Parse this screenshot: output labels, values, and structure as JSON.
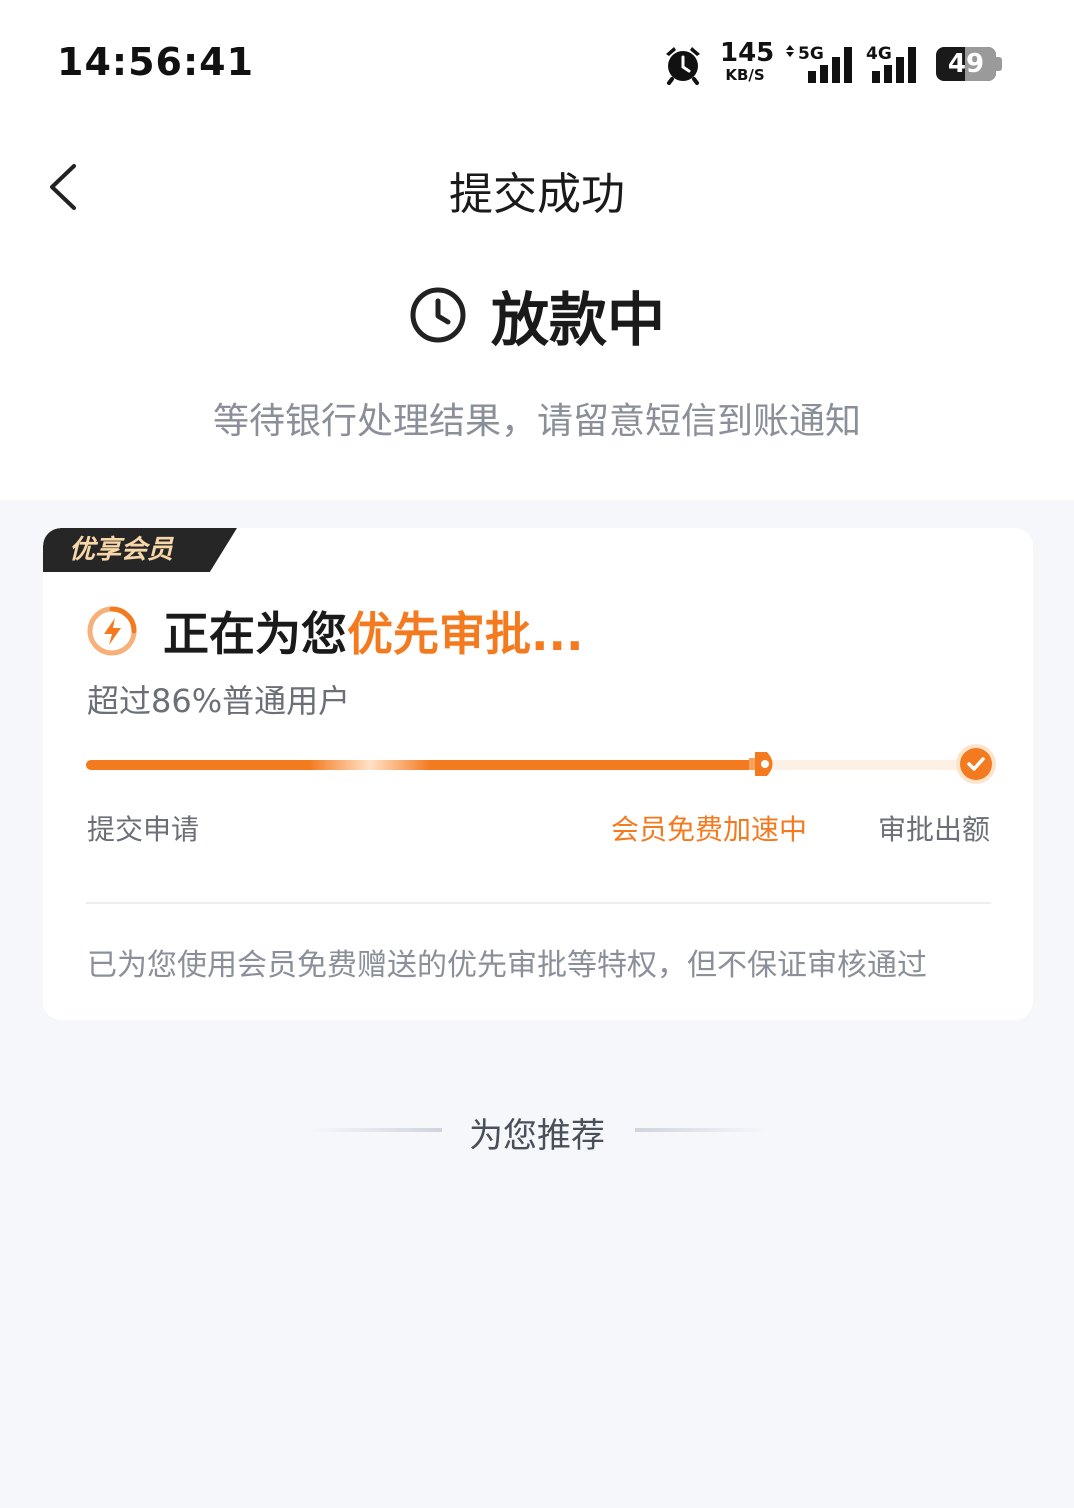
{
  "status_bar": {
    "time": "14:56:41",
    "net_speed": "145",
    "net_speed_unit": "KB/S",
    "signal_1": "5G",
    "signal_2": "4G",
    "battery": "49",
    "battery_level": 0.49
  },
  "nav": {
    "title": "提交成功",
    "back_icon": "chevron-left-icon"
  },
  "result": {
    "status_icon": "clock-icon",
    "title": "放款中",
    "description": "等待银行处理结果，请留意短信到账通知"
  },
  "member_card": {
    "badge": "优享会员",
    "headline_prefix": "正在为您",
    "headline_highlight": "优先审批...",
    "subline": "超过86%普通用户",
    "progress": 0.76,
    "steps": [
      "提交申请",
      "会员免费加速中",
      "审批出额"
    ],
    "note": "已为您使用会员免费赠送的优先审批等特权，但不保证审核通过",
    "accent_color": "#f47a1f"
  },
  "recommend": {
    "title": "为您推荐"
  }
}
